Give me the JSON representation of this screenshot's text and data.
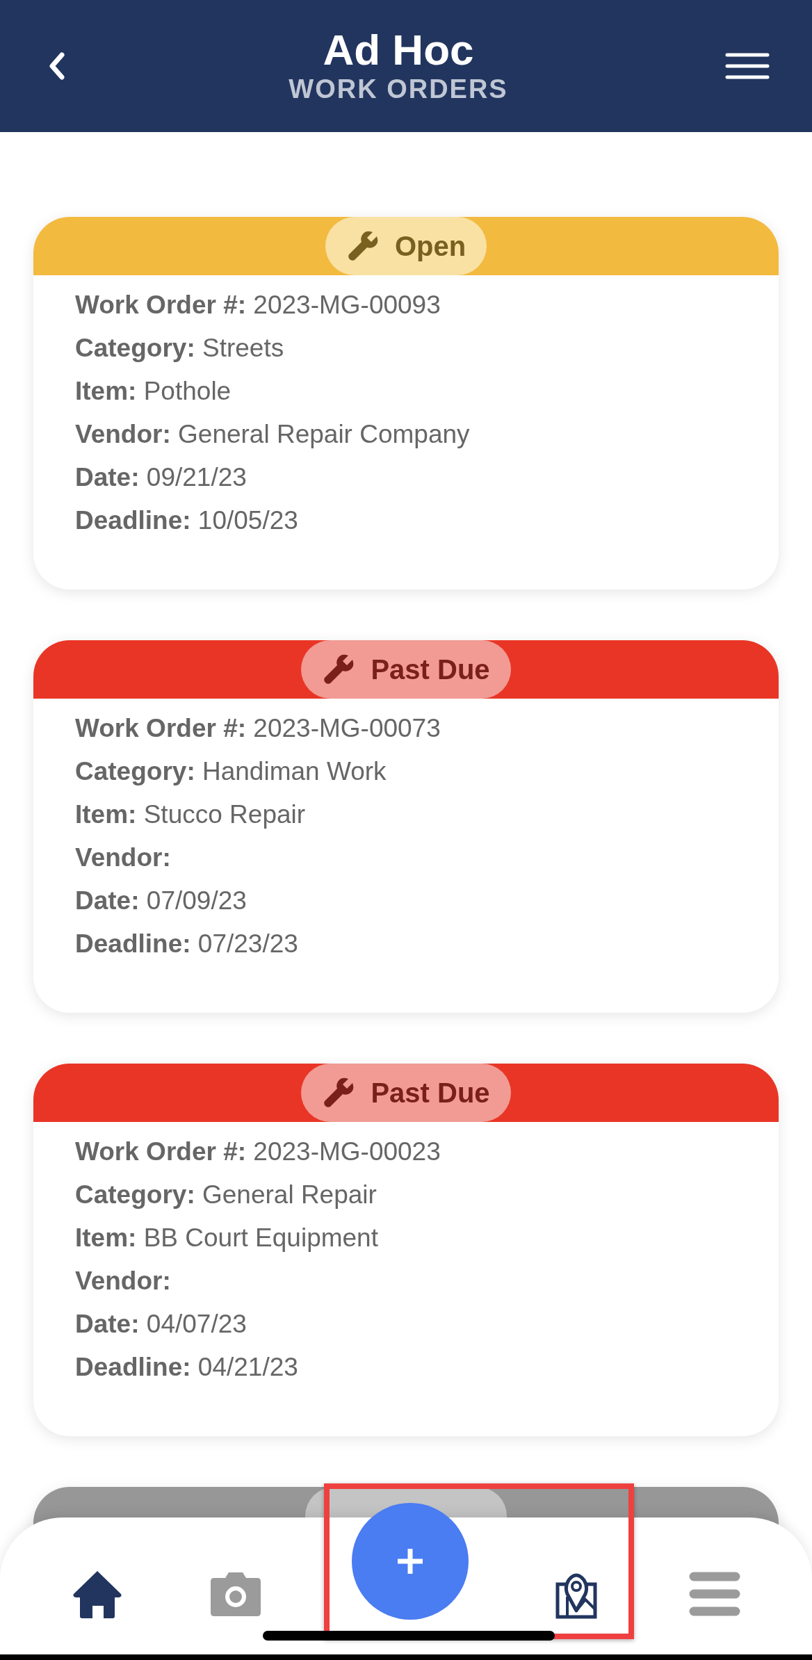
{
  "header": {
    "title": "Ad Hoc",
    "subtitle": "WORK ORDERS"
  },
  "orders": [
    {
      "status": {
        "kind": "open",
        "label": "Open",
        "color": "#f3ba40"
      },
      "fields": [
        {
          "label": "Work Order #:",
          "value": "2023-MG-00093"
        },
        {
          "label": "Category:",
          "value": "Streets"
        },
        {
          "label": "Item:",
          "value": "Pothole"
        },
        {
          "label": "Vendor:",
          "value": "General Repair Company"
        },
        {
          "label": "Date:",
          "value": "09/21/23"
        },
        {
          "label": "Deadline:",
          "value": "10/05/23"
        }
      ]
    },
    {
      "status": {
        "kind": "past_due",
        "label": "Past Due",
        "color": "#e93526"
      },
      "fields": [
        {
          "label": "Work Order #:",
          "value": "2023-MG-00073"
        },
        {
          "label": "Category:",
          "value": "Handiman Work"
        },
        {
          "label": "Item:",
          "value": "Stucco Repair"
        },
        {
          "label": "Vendor:"
        },
        {
          "label": "Date:",
          "value": "07/09/23"
        },
        {
          "label": "Deadline:",
          "value": "07/23/23"
        }
      ]
    },
    {
      "status": {
        "kind": "past_due",
        "label": "Past Due",
        "color": "#e93526"
      },
      "fields": [
        {
          "label": "Work Order #:",
          "value": "2023-MG-00023"
        },
        {
          "label": "Category:",
          "value": "General Repair"
        },
        {
          "label": "Item:",
          "value": "BB Court Equipment"
        },
        {
          "label": "Vendor:"
        },
        {
          "label": "Date:",
          "value": "04/07/23"
        },
        {
          "label": "Deadline:",
          "value": "04/21/23"
        }
      ]
    },
    {
      "status": {
        "kind": "closed",
        "color": "#979797"
      }
    }
  ]
}
